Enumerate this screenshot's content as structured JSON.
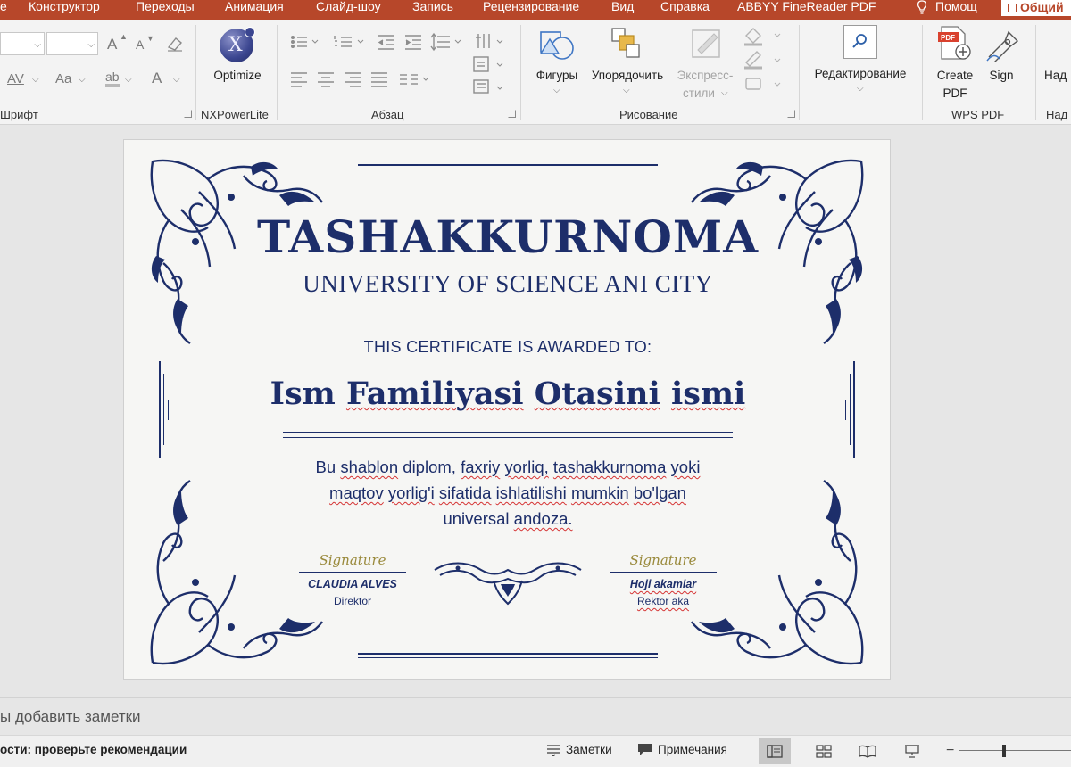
{
  "menu": {
    "tabs": [
      "е",
      "Конструктор",
      "Переходы",
      "Анимация",
      "Слайд-шоу",
      "Запись",
      "Рецензирование",
      "Вид",
      "Справка",
      "ABBYY FineReader PDF"
    ],
    "help": "Помощ",
    "share": "Общий"
  },
  "ribbon": {
    "groups": {
      "font": "Шрифт",
      "nxpowerlite": "NXPowerLite",
      "paragraph": "Абзац",
      "drawing": "Рисование",
      "wpspdf": "WPS PDF",
      "extra": "Над"
    },
    "buttons": {
      "optimize": "Optimize",
      "shapes": "Фигуры",
      "arrange": "Упорядочить",
      "quickstyles_1": "Экспресс-",
      "quickstyles_2": "стили",
      "editing": "Редактирование",
      "createpdf_1": "Create",
      "createpdf_2": "PDF",
      "sign": "Sign",
      "extra": "Над"
    },
    "font_glyphs": {
      "grow": "A",
      "shrink": "A",
      "spacing": "AV",
      "case": "Aa",
      "highlight": "ab",
      "color": "A"
    }
  },
  "certificate": {
    "title": "TASHAKKURNOMA",
    "subtitle": "UNIVERSITY OF SCIENCE ANI CITY",
    "awarded": "THIS CERTIFICATE IS AWARDED TO:",
    "name_parts": [
      "Ism",
      "Familiyasi",
      "Otasini",
      "ismi"
    ],
    "body_line1": [
      "Bu",
      "shablon",
      "diplom,",
      "faxriy",
      "yorliq,",
      "tashakkurnoma",
      "yoki"
    ],
    "body_line2": [
      "maqtov",
      "yorlig'i",
      "sifatida",
      "ishlatilishi",
      "mumkin",
      "bo'lgan"
    ],
    "body_line3": [
      "universal",
      "andoza."
    ],
    "left_signature": {
      "script": "Signature",
      "name": "CLAUDIA ALVES",
      "role": "Direktor"
    },
    "right_signature": {
      "script": "Signature",
      "name": "Hoji akamlar",
      "role": "Rektor aka"
    }
  },
  "notes_placeholder": "ы добавить заметки",
  "status": {
    "accessibility": "ости: проверьте рекомендации",
    "notes": "Заметки",
    "comments": "Примечания"
  },
  "colors": {
    "menu": "#b7472a",
    "navy": "#1d2e6a",
    "gold": "#9a8a3c"
  }
}
